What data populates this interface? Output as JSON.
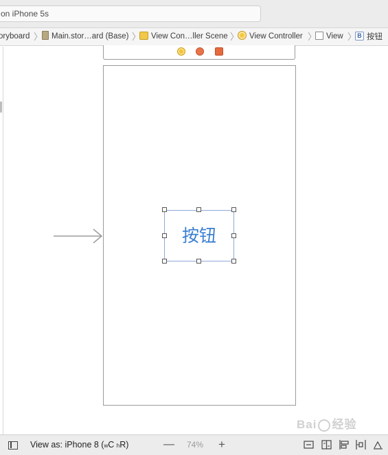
{
  "status_field": {
    "text": "on iPhone 5s"
  },
  "breadcrumb": {
    "items": [
      {
        "label": "oryboard",
        "icon": "storyboard-icon"
      },
      {
        "label": "Main.stor…ard (Base)",
        "icon": "file-icon"
      },
      {
        "label": "View Con…ller Scene",
        "icon": "scene-icon"
      },
      {
        "label": "View Controller",
        "icon": "view-controller-icon"
      },
      {
        "label": "View",
        "icon": "view-icon"
      },
      {
        "label": "按钮",
        "icon": "button-icon",
        "icon_text": "B"
      }
    ],
    "separator": "〉"
  },
  "canvas": {
    "scene_dock_icons": [
      "view-controller-icon",
      "first-responder-icon",
      "exit-icon"
    ],
    "button": {
      "title": "按钮",
      "color": "#3a7fd0"
    },
    "selection_color": "#8fa8d8"
  },
  "bottom_bar": {
    "view_as_prefix": "View as: iPhone 8 (",
    "size_w": "w",
    "size_w_val": "C ",
    "size_h": "h",
    "size_h_val": "R)",
    "zoom_out": "—",
    "zoom_level": "74%",
    "zoom_in": "+",
    "tools": [
      "update-frames-icon",
      "embed-in-stack-icon",
      "align-icon",
      "pin-icon",
      "resolve-issues-icon"
    ]
  },
  "watermark": {
    "text": "Bai",
    "text2": "经验"
  }
}
